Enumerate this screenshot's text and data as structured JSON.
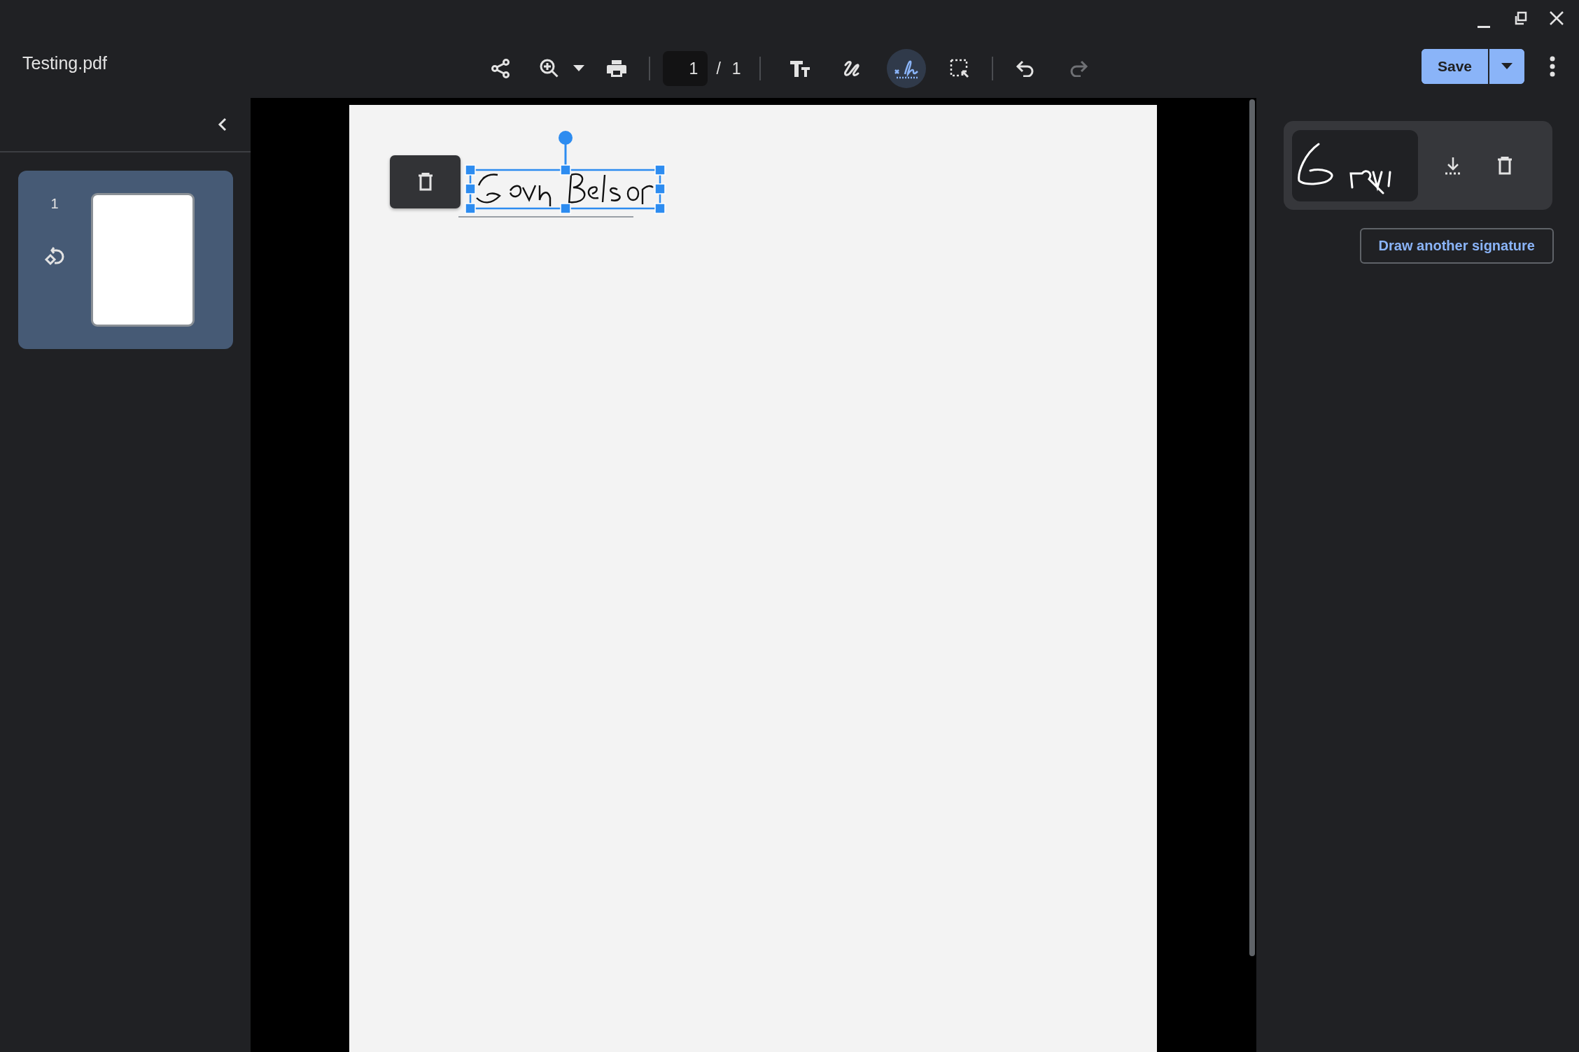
{
  "window": {
    "title": "Testing.pdf"
  },
  "toolbar": {
    "page_input": "1",
    "page_separator": "/",
    "page_total": "1",
    "tools": [
      {
        "kind": "text",
        "selected": false
      },
      {
        "kind": "draw",
        "selected": false
      },
      {
        "kind": "signature",
        "selected": true
      },
      {
        "kind": "select",
        "selected": false
      }
    ],
    "history": [
      {
        "kind": "undo",
        "disabled": false
      },
      {
        "kind": "redo",
        "disabled": true
      }
    ],
    "save_button": "Save"
  },
  "sidebar": {
    "thumbnails": [
      {
        "page": "1",
        "selected": true
      }
    ]
  },
  "signature_panel": {
    "action": "Draw another signature"
  }
}
